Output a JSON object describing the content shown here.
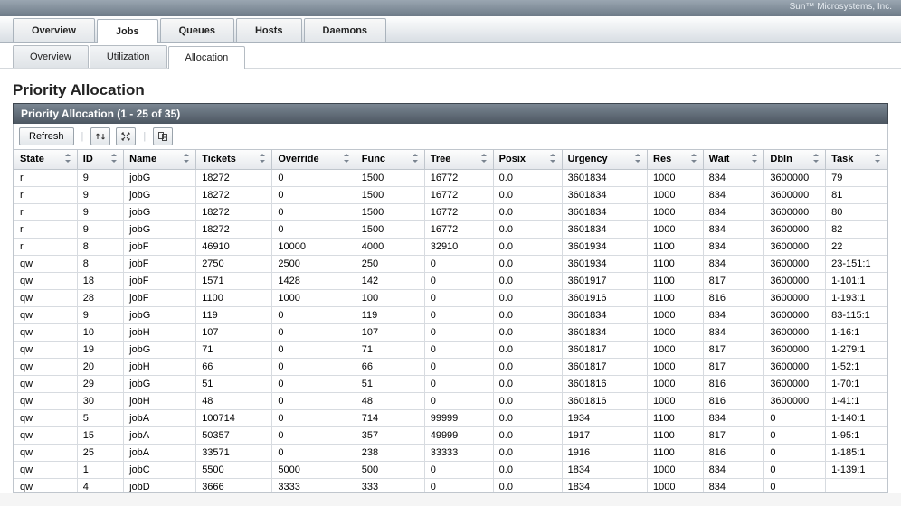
{
  "brand": "Sun™ Microsystems, Inc.",
  "tabs": [
    "Overview",
    "Jobs",
    "Queues",
    "Hosts",
    "Daemons"
  ],
  "active_tab": "Jobs",
  "subtabs": [
    "Overview",
    "Utilization",
    "Allocation"
  ],
  "active_subtab": "Allocation",
  "page_title": "Priority Allocation",
  "panel_title": "Priority Allocation (1 - 25 of 35)",
  "toolbar": {
    "refresh_label": "Refresh"
  },
  "columns": [
    {
      "key": "state",
      "label": "State",
      "w": 68
    },
    {
      "key": "id",
      "label": "ID",
      "w": 50
    },
    {
      "key": "name",
      "label": "Name",
      "w": 78
    },
    {
      "key": "tickets",
      "label": "Tickets",
      "w": 82
    },
    {
      "key": "override",
      "label": "Override",
      "w": 90
    },
    {
      "key": "func",
      "label": "Func",
      "w": 74
    },
    {
      "key": "tree",
      "label": "Tree",
      "w": 74
    },
    {
      "key": "posix",
      "label": "Posix",
      "w": 74
    },
    {
      "key": "urgency",
      "label": "Urgency",
      "w": 92
    },
    {
      "key": "res",
      "label": "Res",
      "w": 60
    },
    {
      "key": "wait",
      "label": "Wait",
      "w": 66
    },
    {
      "key": "dbln",
      "label": "Dbln",
      "w": 66
    },
    {
      "key": "task",
      "label": "Task",
      "w": 66
    }
  ],
  "rows": [
    {
      "state": "r",
      "id": "9",
      "name": "jobG",
      "tickets": "18272",
      "override": "0",
      "func": "1500",
      "tree": "16772",
      "posix": "0.0",
      "urgency": "3601834",
      "res": "1000",
      "wait": "834",
      "dbln": "3600000",
      "task": "79"
    },
    {
      "state": "r",
      "id": "9",
      "name": "jobG",
      "tickets": "18272",
      "override": "0",
      "func": "1500",
      "tree": "16772",
      "posix": "0.0",
      "urgency": "3601834",
      "res": "1000",
      "wait": "834",
      "dbln": "3600000",
      "task": "81"
    },
    {
      "state": "r",
      "id": "9",
      "name": "jobG",
      "tickets": "18272",
      "override": "0",
      "func": "1500",
      "tree": "16772",
      "posix": "0.0",
      "urgency": "3601834",
      "res": "1000",
      "wait": "834",
      "dbln": "3600000",
      "task": "80"
    },
    {
      "state": "r",
      "id": "9",
      "name": "jobG",
      "tickets": "18272",
      "override": "0",
      "func": "1500",
      "tree": "16772",
      "posix": "0.0",
      "urgency": "3601834",
      "res": "1000",
      "wait": "834",
      "dbln": "3600000",
      "task": "82"
    },
    {
      "state": "r",
      "id": "8",
      "name": "jobF",
      "tickets": "46910",
      "override": "10000",
      "func": "4000",
      "tree": "32910",
      "posix": "0.0",
      "urgency": "3601934",
      "res": "1100",
      "wait": "834",
      "dbln": "3600000",
      "task": "22"
    },
    {
      "state": "qw",
      "id": "8",
      "name": "jobF",
      "tickets": "2750",
      "override": "2500",
      "func": "250",
      "tree": "0",
      "posix": "0.0",
      "urgency": "3601934",
      "res": "1100",
      "wait": "834",
      "dbln": "3600000",
      "task": "23-151:1"
    },
    {
      "state": "qw",
      "id": "18",
      "name": "jobF",
      "tickets": "1571",
      "override": "1428",
      "func": "142",
      "tree": "0",
      "posix": "0.0",
      "urgency": "3601917",
      "res": "1100",
      "wait": "817",
      "dbln": "3600000",
      "task": "1-101:1"
    },
    {
      "state": "qw",
      "id": "28",
      "name": "jobF",
      "tickets": "1100",
      "override": "1000",
      "func": "100",
      "tree": "0",
      "posix": "0.0",
      "urgency": "3601916",
      "res": "1100",
      "wait": "816",
      "dbln": "3600000",
      "task": "1-193:1"
    },
    {
      "state": "qw",
      "id": "9",
      "name": "jobG",
      "tickets": "119",
      "override": "0",
      "func": "119",
      "tree": "0",
      "posix": "0.0",
      "urgency": "3601834",
      "res": "1000",
      "wait": "834",
      "dbln": "3600000",
      "task": "83-115:1"
    },
    {
      "state": "qw",
      "id": "10",
      "name": "jobH",
      "tickets": "107",
      "override": "0",
      "func": "107",
      "tree": "0",
      "posix": "0.0",
      "urgency": "3601834",
      "res": "1000",
      "wait": "834",
      "dbln": "3600000",
      "task": "1-16:1"
    },
    {
      "state": "qw",
      "id": "19",
      "name": "jobG",
      "tickets": "71",
      "override": "0",
      "func": "71",
      "tree": "0",
      "posix": "0.0",
      "urgency": "3601817",
      "res": "1000",
      "wait": "817",
      "dbln": "3600000",
      "task": "1-279:1"
    },
    {
      "state": "qw",
      "id": "20",
      "name": "jobH",
      "tickets": "66",
      "override": "0",
      "func": "66",
      "tree": "0",
      "posix": "0.0",
      "urgency": "3601817",
      "res": "1000",
      "wait": "817",
      "dbln": "3600000",
      "task": "1-52:1"
    },
    {
      "state": "qw",
      "id": "29",
      "name": "jobG",
      "tickets": "51",
      "override": "0",
      "func": "51",
      "tree": "0",
      "posix": "0.0",
      "urgency": "3601816",
      "res": "1000",
      "wait": "816",
      "dbln": "3600000",
      "task": "1-70:1"
    },
    {
      "state": "qw",
      "id": "30",
      "name": "jobH",
      "tickets": "48",
      "override": "0",
      "func": "48",
      "tree": "0",
      "posix": "0.0",
      "urgency": "3601816",
      "res": "1000",
      "wait": "816",
      "dbln": "3600000",
      "task": "1-41:1"
    },
    {
      "state": "qw",
      "id": "5",
      "name": "jobA",
      "tickets": "100714",
      "override": "0",
      "func": "714",
      "tree": "99999",
      "posix": "0.0",
      "urgency": "1934",
      "res": "1100",
      "wait": "834",
      "dbln": "0",
      "task": "1-140:1"
    },
    {
      "state": "qw",
      "id": "15",
      "name": "jobA",
      "tickets": "50357",
      "override": "0",
      "func": "357",
      "tree": "49999",
      "posix": "0.0",
      "urgency": "1917",
      "res": "1100",
      "wait": "817",
      "dbln": "0",
      "task": "1-95:1"
    },
    {
      "state": "qw",
      "id": "25",
      "name": "jobA",
      "tickets": "33571",
      "override": "0",
      "func": "238",
      "tree": "33333",
      "posix": "0.0",
      "urgency": "1916",
      "res": "1100",
      "wait": "816",
      "dbln": "0",
      "task": "1-185:1"
    },
    {
      "state": "qw",
      "id": "1",
      "name": "jobC",
      "tickets": "5500",
      "override": "5000",
      "func": "500",
      "tree": "0",
      "posix": "0.0",
      "urgency": "1834",
      "res": "1000",
      "wait": "834",
      "dbln": "0",
      "task": "1-139:1"
    },
    {
      "state": "qw",
      "id": "4",
      "name": "jobD",
      "tickets": "3666",
      "override": "3333",
      "func": "333",
      "tree": "0",
      "posix": "0.0",
      "urgency": "1834",
      "res": "1000",
      "wait": "834",
      "dbln": "0",
      "task": ""
    }
  ]
}
